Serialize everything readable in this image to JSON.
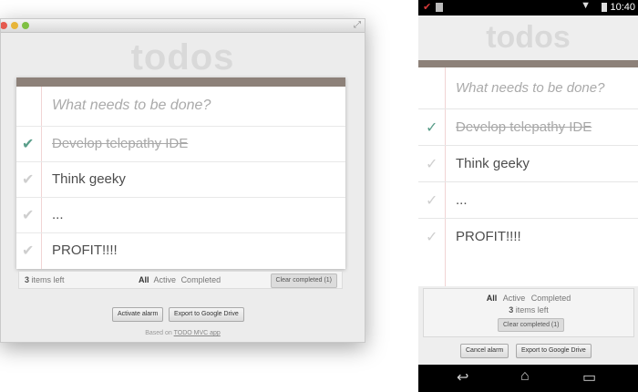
{
  "desktop": {
    "title": "todos",
    "input_placeholder": "What needs to be done?",
    "todos": [
      {
        "text": "Develop telepathy IDE",
        "done": true
      },
      {
        "text": "Think geeky",
        "done": false
      },
      {
        "text": "...",
        "done": false
      },
      {
        "text": "PROFIT!!!!",
        "done": false
      }
    ],
    "footer": {
      "count": "3",
      "count_suffix": " items left",
      "filters": [
        "All",
        "Active",
        "Completed"
      ],
      "clear": "Clear completed (1)"
    },
    "buttons": {
      "alarm": "Activate alarm",
      "export": "Export to Google Drive"
    },
    "based_prefix": "Based on ",
    "based_link": "TODO MVC app"
  },
  "phone": {
    "status_time": "10:40",
    "title": "todos",
    "input_placeholder": "What needs to be done?",
    "todos": [
      {
        "text": "Develop telepathy IDE",
        "done": true
      },
      {
        "text": "Think geeky",
        "done": false
      },
      {
        "text": "...",
        "done": false
      },
      {
        "text": "PROFIT!!!!",
        "done": false
      }
    ],
    "footer": {
      "filters": [
        "All",
        "Active",
        "Completed"
      ],
      "count": "3",
      "count_suffix": " items left",
      "clear": "Clear completed (1)"
    },
    "buttons": {
      "alarm": "Cancel alarm",
      "export": "Export to Google Drive"
    }
  },
  "icons": {
    "check": "check-icon",
    "back": "back-icon",
    "home": "home-icon",
    "recent": "recent-apps-icon"
  },
  "colors": {
    "band": "#8d8179",
    "check_done": "#5a9e8a",
    "title": "#d9d9d9"
  }
}
